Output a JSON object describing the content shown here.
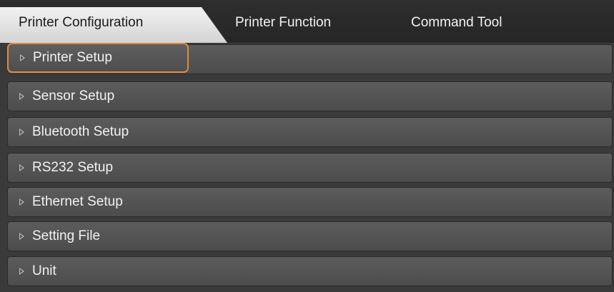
{
  "tabs": [
    {
      "label": "Printer Configuration",
      "active": true
    },
    {
      "label": "Printer Function",
      "active": false
    },
    {
      "label": "Command Tool",
      "active": false
    }
  ],
  "sections": [
    {
      "label": "Printer Setup",
      "selected": true
    },
    {
      "label": "Sensor Setup"
    },
    {
      "label": "Bluetooth Setup"
    },
    {
      "label": "RS232 Setup"
    },
    {
      "label": "Ethernet Setup"
    },
    {
      "label": "Setting File"
    },
    {
      "label": "Unit"
    }
  ],
  "colors": {
    "selection_outline": "#e08a3c",
    "background": "#3a3a3a",
    "row": "#555555",
    "text": "#f2f2f2"
  },
  "icons": {
    "expander": "triangle-right-icon"
  }
}
